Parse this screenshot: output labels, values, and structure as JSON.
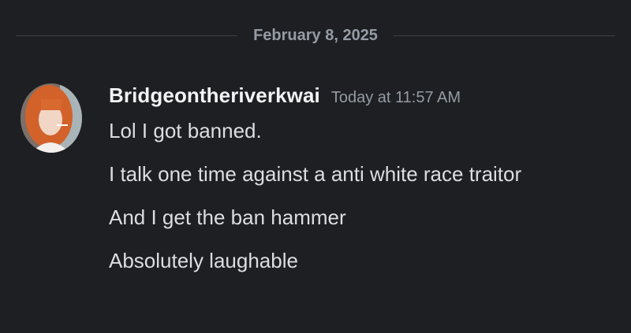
{
  "divider": {
    "date": "February 8, 2025"
  },
  "message": {
    "username": "Bridgeontheriverkwai",
    "timestamp": "Today at 11:57 AM",
    "lines": [
      "Lol I got banned.",
      "I talk one time against a anti white race traitor",
      "And I get the ban hammer",
      "Absolutely laughable"
    ]
  },
  "colors": {
    "background": "#1e1f22",
    "username": "#f2f3f5",
    "text": "#dbdee1",
    "muted": "#949ba4",
    "divider": "#3f4147"
  }
}
